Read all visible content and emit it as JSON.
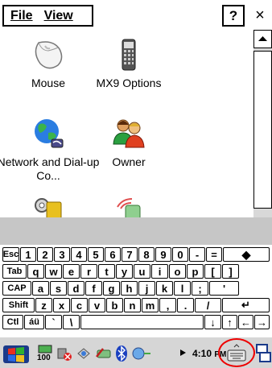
{
  "menubar": {
    "file_label": "File",
    "view_label": "View",
    "help_label": "?",
    "close_label": "×"
  },
  "items": [
    {
      "label": "Mouse",
      "icon": "mouse-icon"
    },
    {
      "label": "MX9 Options",
      "icon": "handheld-device-icon"
    },
    {
      "label": "Network and Dial-up Co...",
      "icon": "network-globe-icon"
    },
    {
      "label": "Owner",
      "icon": "owner-people-icon"
    },
    {
      "label": "",
      "icon": "password-keys-icon"
    },
    {
      "label": "",
      "icon": "pda-wireless-icon"
    }
  ],
  "keyboard": {
    "row1": [
      "Esc",
      "1",
      "2",
      "3",
      "4",
      "5",
      "6",
      "7",
      "8",
      "9",
      "0",
      "-",
      "=",
      "◆"
    ],
    "row2": [
      "Tab",
      "q",
      "w",
      "e",
      "r",
      "t",
      "y",
      "u",
      "i",
      "o",
      "p",
      "[",
      "]"
    ],
    "row3": [
      "CAP",
      "a",
      "s",
      "d",
      "f",
      "g",
      "h",
      "j",
      "k",
      "l",
      ";",
      "'"
    ],
    "row4": [
      "Shift",
      "z",
      "x",
      "c",
      "v",
      "b",
      "n",
      "m",
      ",",
      ".",
      "/",
      "↵"
    ],
    "row5": [
      "Ctl",
      "áü",
      "`",
      "\\",
      "↓",
      "↑",
      "←",
      "→"
    ]
  },
  "taskbar": {
    "clock": "4:10",
    "ampm": "PM",
    "battery_label": "100",
    "accent_red": "#e00000"
  }
}
